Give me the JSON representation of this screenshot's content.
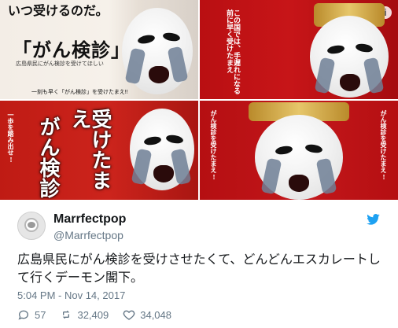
{
  "tweet": {
    "user": {
      "display_name": "Marrfectpop",
      "handle": "@Marrfectpop"
    },
    "text": "広島県民にがん検診を受けさせたくて、どんどんエスカレートして行くデーモン閣下。",
    "timestamp": "5:04 PM - Nov 14, 2017",
    "stats": {
      "replies": "57",
      "retweets": "32,409",
      "likes": "34,048"
    }
  },
  "images": {
    "top_left": {
      "headline": "いつ受けるのだ。",
      "title": "「がん検診」",
      "small_text": "広島県民にがん検診を受けてほしい",
      "line": "一刻も早く「がん検診」を受けたまえ!!"
    },
    "top_right": {
      "vertical_text": "この国では、手遅れになる前に早く受けたまえ"
    },
    "bottom_left": {
      "big_vertical": "受けたまえ",
      "big_vertical_2": "がん検診",
      "small_vertical": "一歩を踏み出せ!"
    },
    "bottom_right": {
      "small_vertical": "がん検診を受けたまえ!"
    }
  },
  "colors": {
    "twitter_blue": "#1da1f2",
    "text_primary": "#14171a",
    "text_secondary": "#657786",
    "red_bg": "#c71518"
  },
  "icons": {
    "info": "info-icon",
    "twitter": "twitter-bird-icon",
    "reply": "reply-icon",
    "retweet": "retweet-icon",
    "like": "heart-icon"
  }
}
